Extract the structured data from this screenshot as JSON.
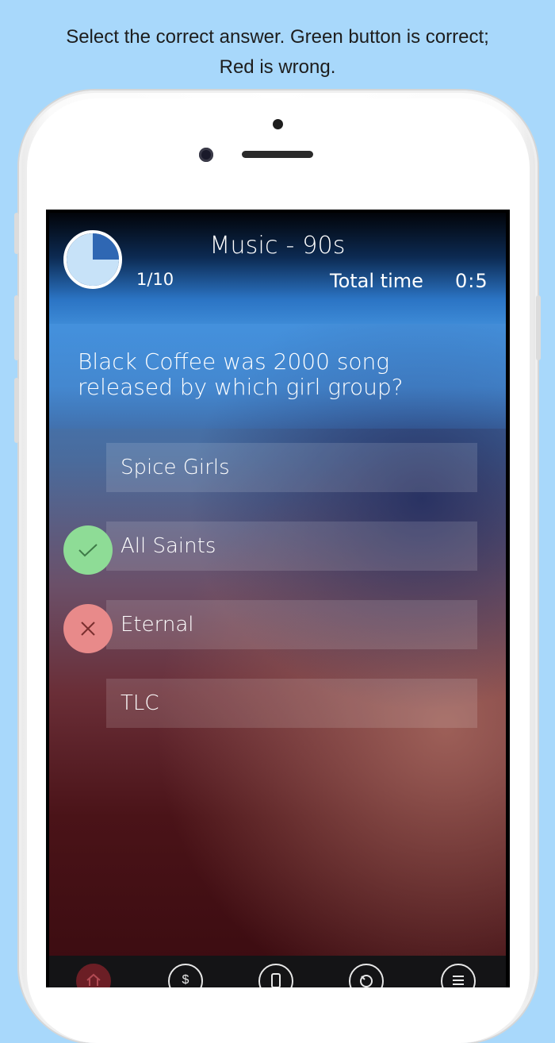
{
  "instruction": {
    "line1": "Select the correct answer. Green button is correct;",
    "line2": "Red is wrong."
  },
  "header": {
    "category": "Music - 90s",
    "progress": "1/10",
    "total_time_label": "Total time",
    "total_time_value": "0:5",
    "timer_fraction_elapsed": 0.25
  },
  "question": {
    "text": "Black Coffee was  2000 song released by which girl group?"
  },
  "answers": [
    {
      "label": "Spice Girls",
      "state": "none"
    },
    {
      "label": "All Saints",
      "state": "correct"
    },
    {
      "label": "Eternal",
      "state": "wrong"
    },
    {
      "label": "TLC",
      "state": "none"
    }
  ],
  "tabbar": {
    "items": [
      {
        "icon": "home-icon",
        "active": true
      },
      {
        "icon": "coins-icon",
        "glyph": "$",
        "active": false
      },
      {
        "icon": "phone-icon",
        "active": false
      },
      {
        "icon": "stats-icon",
        "active": false
      },
      {
        "icon": "menu-icon",
        "active": false
      }
    ]
  },
  "colors": {
    "correct": "#8edc96",
    "wrong": "#e88a8a",
    "background": "#a8d8fb",
    "timer_fill": "#c7e2f8",
    "timer_slice": "#2f67b3"
  }
}
